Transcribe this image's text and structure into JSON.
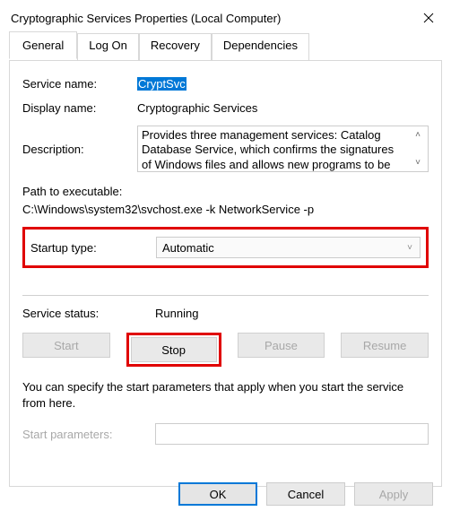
{
  "title": "Cryptographic Services Properties (Local Computer)",
  "tabs": {
    "general": "General",
    "logon": "Log On",
    "recovery": "Recovery",
    "dependencies": "Dependencies"
  },
  "labels": {
    "service_name": "Service name:",
    "display_name": "Display name:",
    "description": "Description:",
    "path_to_exe": "Path to executable:",
    "startup_type": "Startup type:",
    "service_status": "Service status:",
    "start_params": "Start parameters:"
  },
  "values": {
    "service_name": "CryptSvc",
    "display_name": "Cryptographic Services",
    "description": "Provides three management services: Catalog Database Service, which confirms the signatures of Windows files and allows new programs to be",
    "path": "C:\\Windows\\system32\\svchost.exe -k NetworkService -p",
    "startup_type": "Automatic",
    "service_status": "Running",
    "start_params": ""
  },
  "buttons": {
    "start": "Start",
    "stop": "Stop",
    "pause": "Pause",
    "resume": "Resume",
    "ok": "OK",
    "cancel": "Cancel",
    "apply": "Apply"
  },
  "help_text": "You can specify the start parameters that apply when you start the service from here.",
  "colors": {
    "highlight_border": "#e00000",
    "accent": "#0078d7"
  }
}
